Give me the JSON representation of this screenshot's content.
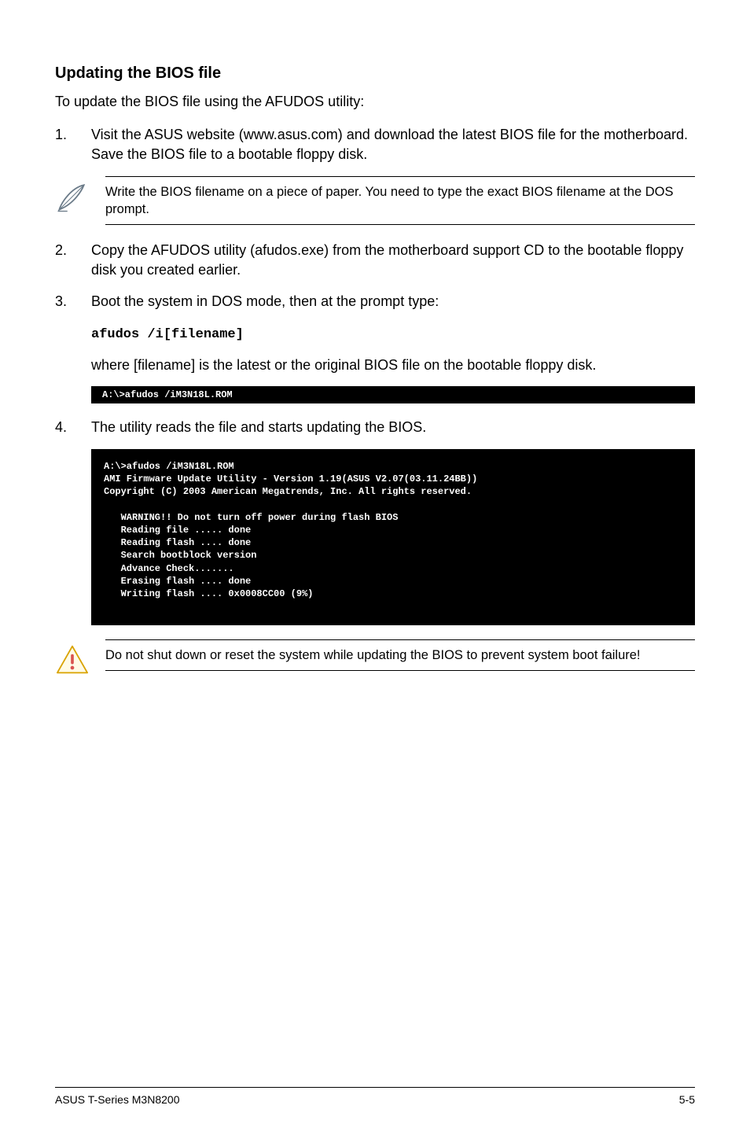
{
  "heading": "Updating the BIOS file",
  "intro": "To update the BIOS file using the AFUDOS utility:",
  "steps": {
    "s1_num": "1.",
    "s1_text": "Visit the ASUS website (www.asus.com) and download the latest BIOS file for the motherboard. Save the BIOS file to a bootable floppy disk.",
    "s2_num": "2.",
    "s2_text": "Copy the AFUDOS utility (afudos.exe) from the motherboard support CD to the bootable floppy disk you created earlier.",
    "s3_num": "3.",
    "s3_text": "Boot the system in DOS mode, then at the prompt type:",
    "s3_cmd": "afudos /i[filename]",
    "s3_expl": "where [filename] is the latest or the original BIOS file on the bootable floppy disk.",
    "s4_num": "4.",
    "s4_text": "The utility reads the file and starts updating the BIOS."
  },
  "note1": "Write the BIOS filename on a piece of paper. You need to type the exact BIOS filename at the DOS prompt.",
  "note2": "Do not shut down or reset the system while updating the BIOS to prevent system boot failure!",
  "terminal1": "A:\\>afudos /iM3N18L.ROM",
  "terminal2": "A:\\>afudos /iM3N18L.ROM\nAMI Firmware Update Utility - Version 1.19(ASUS V2.07(03.11.24BB))\nCopyright (C) 2003 American Megatrends, Inc. All rights reserved.\n\n   WARNING!! Do not turn off power during flash BIOS\n   Reading file ..... done\n   Reading flash .... done\n   Search bootblock version\n   Advance Check.......\n   Erasing flash .... done\n   Writing flash .... 0x0008CC00 (9%)",
  "footer_left": "ASUS T-Series M3N8200",
  "footer_right": "5-5"
}
